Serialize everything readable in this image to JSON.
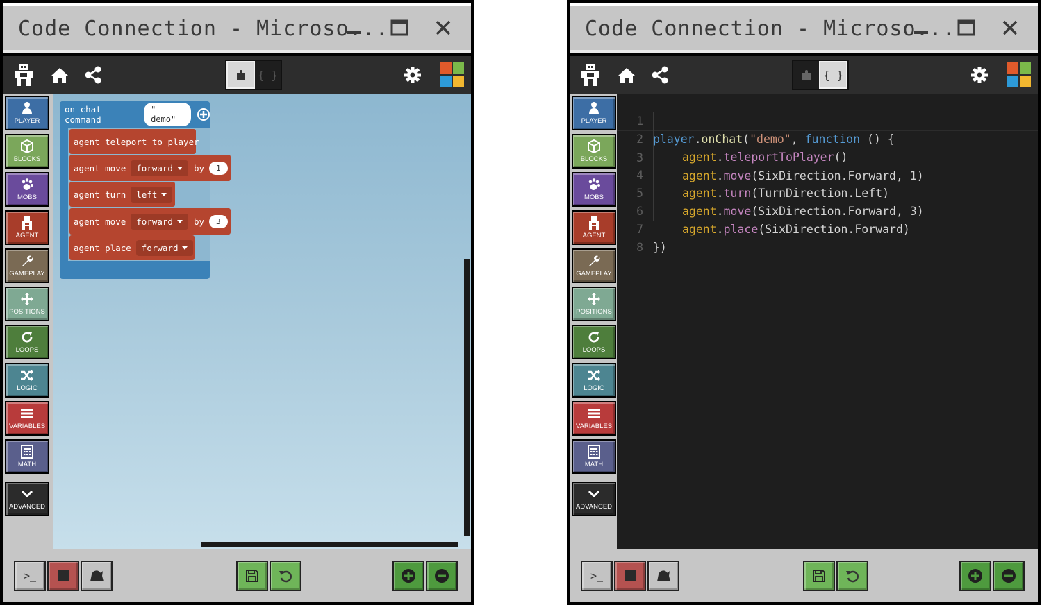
{
  "left_window": {
    "title": "Code Connection - Microso...",
    "mode": "blocks",
    "blocks": {
      "hat_label": "on chat command",
      "hat_value": "\" demo\"",
      "b1": {
        "text": "agent teleport to player"
      },
      "b2": {
        "prefix": "agent move",
        "dir": "forward",
        "by": "by",
        "num": "1"
      },
      "b3": {
        "prefix": "agent turn",
        "dir": "left"
      },
      "b4": {
        "prefix": "agent move",
        "dir": "forward",
        "by": "by",
        "num": "3"
      },
      "b5": {
        "prefix": "agent place",
        "dir": "forward"
      }
    }
  },
  "right_window": {
    "title": "Code Connection - Microso...",
    "mode": "javascript",
    "line_numbers": [
      "1",
      "2",
      "3",
      "4",
      "5",
      "6",
      "7",
      "8"
    ],
    "code": {
      "l1": {
        "a": "player",
        "b": ".",
        "c": "onChat",
        "d": "(",
        "e": "\"demo\"",
        "f": ", ",
        "g": "function",
        "h": " () {"
      },
      "l2": {
        "a": "agent",
        "b": ".",
        "c": "teleportToPlayer",
        "d": "()"
      },
      "l3": {
        "a": "agent",
        "b": ".",
        "c": "move",
        "d": "(SixDirection.Forward, 1)"
      },
      "l4": {
        "a": "agent",
        "b": ".",
        "c": "turn",
        "d": "(TurnDirection.Left)"
      },
      "l5": {
        "a": "agent",
        "b": ".",
        "c": "move",
        "d": "(SixDirection.Forward, 3)"
      },
      "l6": {
        "a": "agent",
        "b": ".",
        "c": "place",
        "d": "(SixDirection.Forward)"
      },
      "l7": {
        "a": "})"
      }
    }
  },
  "toolbar": {
    "blocks_toggle_icon": "puzzle-icon",
    "code_toggle_label": "{ }",
    "icons": [
      "agent-icon",
      "home-icon",
      "share-icon",
      "gear-icon",
      "microsoft-logo"
    ]
  },
  "categories": [
    {
      "label": "PLAYER",
      "icon": "person-icon",
      "color": "#3d6ea5"
    },
    {
      "label": "BLOCKS",
      "icon": "cube-icon",
      "color": "#7ba75b"
    },
    {
      "label": "MOBS",
      "icon": "paw-icon",
      "color": "#6a4b9c"
    },
    {
      "label": "AGENT",
      "icon": "agent-icon",
      "color": "#a83d2a"
    },
    {
      "label": "GAMEPLAY",
      "icon": "wrench-icon",
      "color": "#7a6a54"
    },
    {
      "label": "POSITIONS",
      "icon": "move-icon",
      "color": "#7fa993"
    },
    {
      "label": "LOOPS",
      "icon": "loop-icon",
      "color": "#4e7e3c"
    },
    {
      "label": "LOGIC",
      "icon": "shuffle-icon",
      "color": "#4d8591"
    },
    {
      "label": "VARIABLES",
      "icon": "list-icon",
      "color": "#b83b3b"
    },
    {
      "label": "MATH",
      "icon": "calculator-icon",
      "color": "#5a5f8c"
    },
    {
      "label": "ADVANCED",
      "icon": "chevron-down-icon",
      "color": "#2b2b2b"
    }
  ],
  "bottombar": {
    "console_label": ">_",
    "colors": {
      "stop": "#b55250",
      "save": "#6fb559",
      "zoom": "#4e9a3e",
      "grey": "#c3c3c3"
    }
  }
}
